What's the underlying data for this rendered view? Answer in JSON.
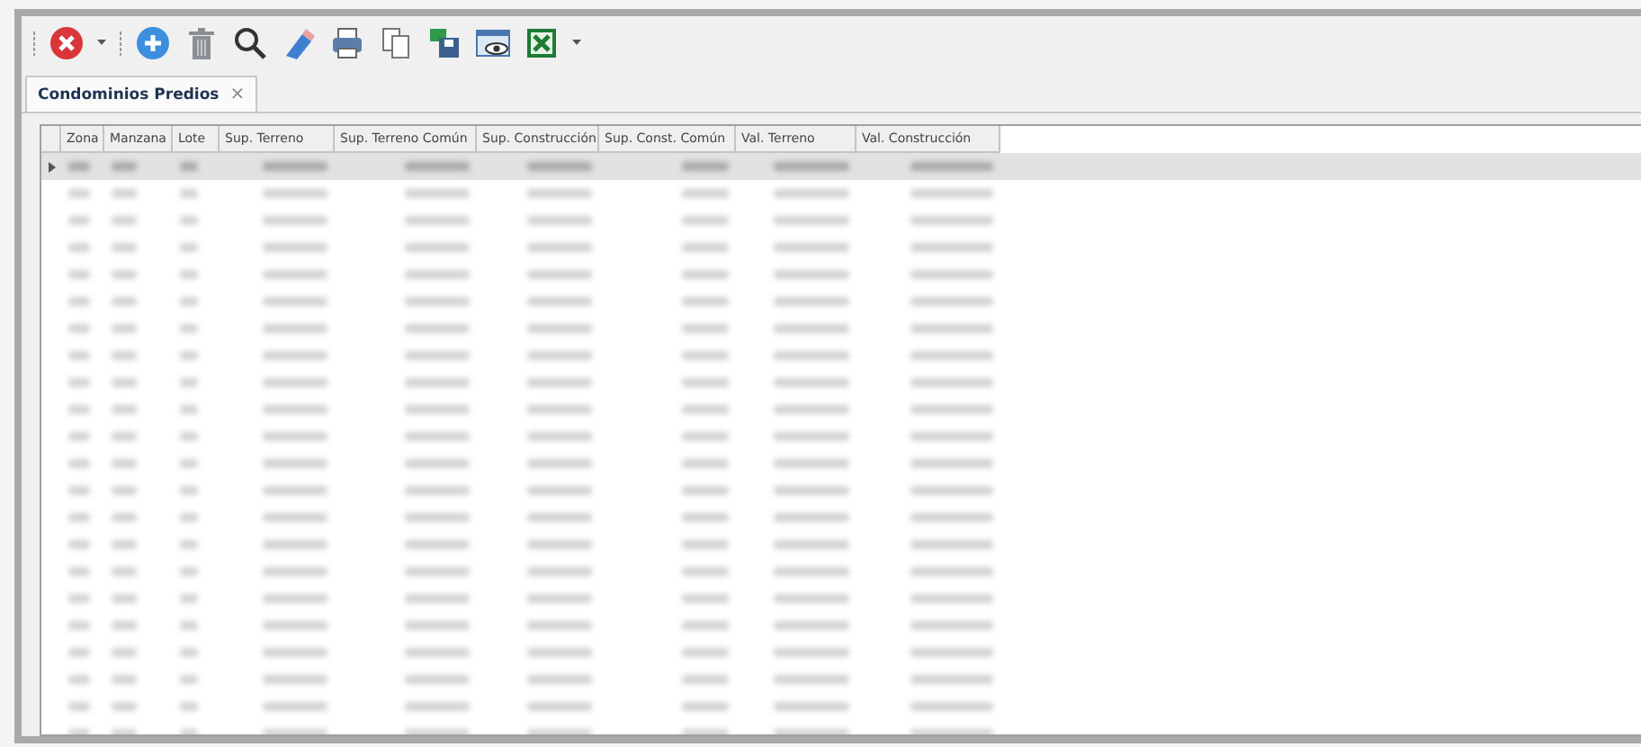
{
  "tab": {
    "label": "Condominios Predios",
    "close": "×",
    "selected": true
  },
  "table": {
    "columns": [
      "Zona",
      "Manzana",
      "Lote",
      "Sup. Terreno",
      "Sup. Terreno Común",
      "Sup. Construcción",
      "Sup. Const. Común",
      "Val. Terreno",
      "Val. Construcción"
    ],
    "rows": [
      {
        "selected": true
      },
      {
        "selected": false
      },
      {
        "selected": false
      },
      {
        "selected": false
      },
      {
        "selected": false
      },
      {
        "selected": false
      },
      {
        "selected": false
      },
      {
        "selected": false
      },
      {
        "selected": false
      },
      {
        "selected": false
      },
      {
        "selected": false
      },
      {
        "selected": false
      },
      {
        "selected": false
      },
      {
        "selected": false
      },
      {
        "selected": false
      },
      {
        "selected": false
      },
      {
        "selected": false
      },
      {
        "selected": false
      },
      {
        "selected": false
      },
      {
        "selected": false
      },
      {
        "selected": false
      },
      {
        "selected": false
      }
    ]
  }
}
